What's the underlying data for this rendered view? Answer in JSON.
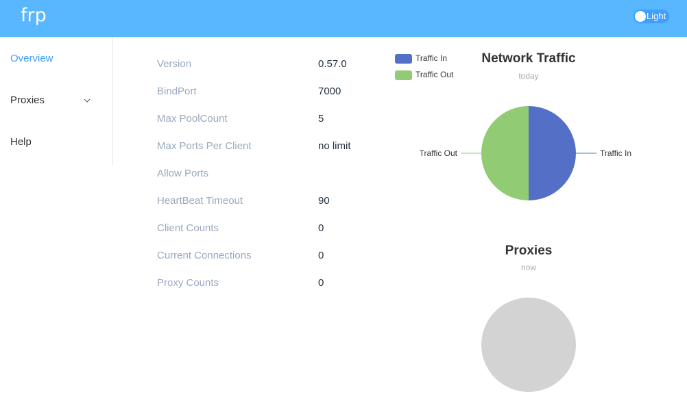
{
  "header": {
    "logo": "frp",
    "theme_label": "Light"
  },
  "sidebar": {
    "items": [
      {
        "label": "Overview",
        "active": true
      },
      {
        "label": "Proxies",
        "has_submenu": true
      },
      {
        "label": "Help"
      }
    ]
  },
  "server_info": [
    {
      "key": "Version",
      "value": "0.57.0"
    },
    {
      "key": "BindPort",
      "value": "7000"
    },
    {
      "key": "Max PoolCount",
      "value": "5"
    },
    {
      "key": "Max Ports Per Client",
      "value": "no limit"
    },
    {
      "key": "Allow Ports",
      "value": ""
    },
    {
      "key": "HeartBeat Timeout",
      "value": "90"
    },
    {
      "key": "Client Counts",
      "value": "0"
    },
    {
      "key": "Current Connections",
      "value": "0"
    },
    {
      "key": "Proxy Counts",
      "value": "0"
    }
  ],
  "colors": {
    "header_bg": "#58b7ff",
    "accent": "#409eff",
    "traffic_in": "#5470c6",
    "traffic_out": "#91cc75",
    "empty_pie": "#d3d3d3"
  },
  "chart_data": [
    {
      "type": "pie",
      "title": "Network Traffic",
      "subtitle": "today",
      "legend": [
        "Traffic In",
        "Traffic Out"
      ],
      "legend_position": "top-left",
      "labels": [
        "Traffic In",
        "Traffic Out"
      ],
      "values": [
        1,
        1
      ]
    },
    {
      "type": "pie",
      "title": "Proxies",
      "subtitle": "now",
      "labels": [],
      "values": []
    }
  ]
}
